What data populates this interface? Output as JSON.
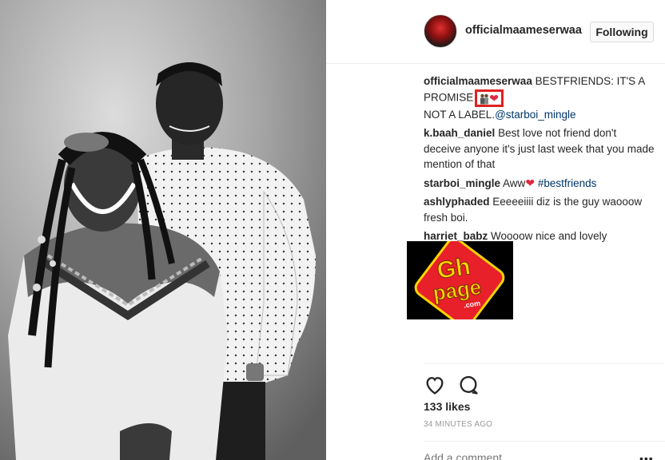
{
  "post": {
    "username": "officialmaameserwaa",
    "follow_label": "Following",
    "caption": {
      "author": "officialmaameserwaa",
      "line1": "BESTFRIENDS: IT'S A",
      "line2": "PROMISE",
      "line3": "NOT A LABEL.",
      "mention": "@starboi_mingle"
    },
    "comments": [
      {
        "user": "k.baah_daniel",
        "text": "Best love not friend don't deceive anyone it's just last week that you made mention of that"
      },
      {
        "user": "starboi_mingle",
        "text": "Aww",
        "tag": "#bestfriends"
      },
      {
        "user": "ashlyphaded",
        "text": "Eeeeeiiii diz is the guy waooow fresh boi."
      },
      {
        "user": "harriet_babz",
        "text": "Woooow nice and lovely"
      }
    ],
    "likes": "133 likes",
    "timestamp": "34 MINUTES AGO",
    "add_comment_placeholder": "Add a comment…",
    "more_glyph": "•••"
  },
  "logo": {
    "top": "Gh",
    "bottom": "page",
    "sub": ".com"
  },
  "colors": {
    "link": "#003569",
    "heart": "#e0283f",
    "highlight_box": "#e02020",
    "logo_red": "#e8202a",
    "logo_yellow": "#ffd400"
  }
}
